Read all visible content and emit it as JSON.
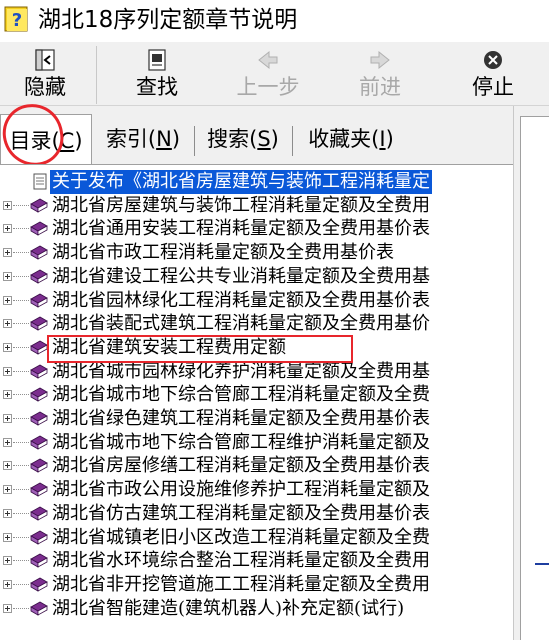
{
  "window": {
    "title": "湖北18序列定额章节说明",
    "icon": "help-question-icon"
  },
  "toolbar": {
    "hide_label": "隐藏",
    "find_label": "查找",
    "back_label": "上一步",
    "forward_label": "前进",
    "stop_label": "停止"
  },
  "tabs": [
    {
      "pre": "目录(",
      "key": "C",
      "post": ")",
      "active": true
    },
    {
      "pre": "索引(",
      "key": "N",
      "post": ")",
      "active": false
    },
    {
      "pre": "搜索(",
      "key": "S",
      "post": ")",
      "active": false
    },
    {
      "pre": "收藏夹(",
      "key": "I",
      "post": ")",
      "active": false
    }
  ],
  "tree": {
    "items": [
      {
        "label": "关于发布《湖北省房屋建筑与装饰工程消耗量定",
        "type": "document",
        "selected": true
      },
      {
        "label": "湖北省房屋建筑与装饰工程消耗量定额及全费用",
        "type": "book"
      },
      {
        "label": "湖北省通用安装工程消耗量定额及全费用基价表",
        "type": "book"
      },
      {
        "label": "湖北省市政工程消耗量定额及全费用基价表",
        "type": "book"
      },
      {
        "label": "湖北省建设工程公共专业消耗量定额及全费用基",
        "type": "book"
      },
      {
        "label": "湖北省园林绿化工程消耗量定额及全费用基价表",
        "type": "book"
      },
      {
        "label": "湖北省装配式建筑工程消耗量定额及全费用基价",
        "type": "book"
      },
      {
        "label": "湖北省建筑安装工程费用定额",
        "type": "book",
        "highlighted": true
      },
      {
        "label": "湖北省城市园林绿化养护消耗量定额及全费用基",
        "type": "book"
      },
      {
        "label": "湖北省城市地下综合管廊工程消耗量定额及全费",
        "type": "book"
      },
      {
        "label": "湖北省绿色建筑工程消耗量定额及全费用基价表",
        "type": "book"
      },
      {
        "label": "湖北省城市地下综合管廊工程维护消耗量定额及",
        "type": "book"
      },
      {
        "label": "湖北省房屋修缮工程消耗量定额及全费用基价表",
        "type": "book"
      },
      {
        "label": "湖北省市政公用设施维修养护工程消耗量定额及",
        "type": "book"
      },
      {
        "label": "湖北省仿古建筑工程消耗量定额及全费用基价表",
        "type": "book"
      },
      {
        "label": "湖北省城镇老旧小区改造工程消耗量定额及全费",
        "type": "book"
      },
      {
        "label": "湖北省水环境综合整治工程消耗量定额及全费用",
        "type": "book"
      },
      {
        "label": "湖北省非开挖管道施工工程消耗量定额及全费用",
        "type": "book"
      },
      {
        "label": "湖北省智能建造(建筑机器人)补充定额(试行)",
        "type": "book"
      }
    ]
  },
  "colors": {
    "selection": "#0a58d8",
    "annotation": "#e8262c",
    "book": "#7b2d8e"
  }
}
